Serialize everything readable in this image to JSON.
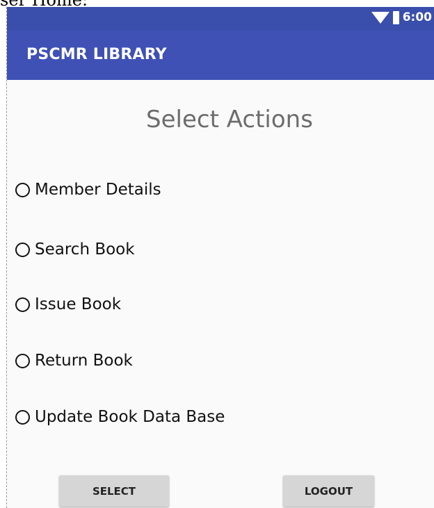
{
  "caption": "ser Home:",
  "status_bar": {
    "time": "6:00",
    "icons": [
      "wifi-icon",
      "battery-icon"
    ],
    "color": "#3a4fab"
  },
  "app_bar": {
    "title": "PSCMR LIBRARY",
    "color": "#3f51b5"
  },
  "screen": {
    "title": "Select Actions"
  },
  "options": [
    {
      "label": "Member Details",
      "checked": false
    },
    {
      "label": "Search Book",
      "checked": false
    },
    {
      "label": "Issue Book",
      "checked": false
    },
    {
      "label": "Return Book",
      "checked": false
    },
    {
      "label": "Update Book Data Base",
      "checked": false
    }
  ],
  "buttons": {
    "select_label": "SELECT",
    "logout_label": "LOGOUT"
  }
}
